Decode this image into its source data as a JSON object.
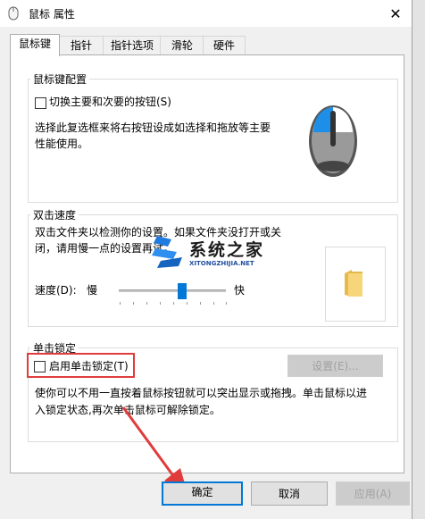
{
  "window": {
    "title": "鼠标 属性",
    "close_symbol": "✕"
  },
  "tabs": [
    "鼠标键",
    "指针",
    "指针选项",
    "滑轮",
    "硬件"
  ],
  "button_config": {
    "group_label": "鼠标键配置",
    "checkbox_label": "切换主要和次要的按钮(S)",
    "description_line1": "选择此复选框来将右按钮设成如选择和拖放等主要",
    "description_line2": "性能使用。"
  },
  "double_click": {
    "group_label": "双击速度",
    "description_line1": "双击文件夹以检测你的设置。如果文件夹没打开或关",
    "description_line2": "闭，请用慢一点的设置再试。",
    "speed_label": "速度(D):",
    "slow": "慢",
    "fast": "快",
    "slider_level": 0.58
  },
  "click_lock": {
    "group_label": "单击锁定",
    "checkbox_label": "启用单击锁定(T)",
    "settings_button": "设置(E)...",
    "description_line1": "使你可以不用一直按着鼠标按钮就可以突出显示或拖拽。单击鼠标以进",
    "description_line2": "入锁定状态,再次单击鼠标可解除锁定。"
  },
  "watermark": {
    "title": "系统之家",
    "subtitle": "XITONGZHIJIA.NET"
  },
  "footer": {
    "ok": "确定",
    "cancel": "取消",
    "apply": "应用(A)"
  },
  "colors": {
    "accent": "#0078d7",
    "annotation": "#e03c3c"
  }
}
